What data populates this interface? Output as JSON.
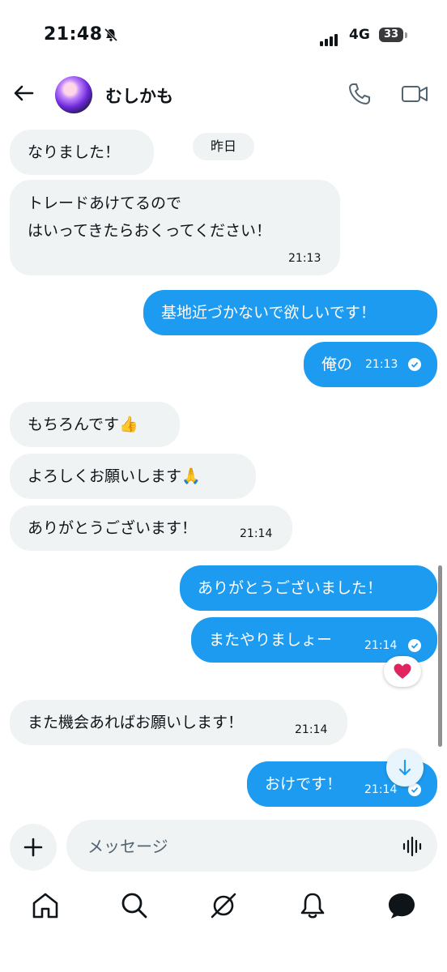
{
  "status_bar": {
    "time": "21:48",
    "network": "4G",
    "battery": "33"
  },
  "header": {
    "contact_name": "むしかも"
  },
  "day_separator": "昨日",
  "messages": [
    {
      "dir": "in",
      "text": "なりました！"
    },
    {
      "dir": "in",
      "lines": [
        "トレードあけてるので",
        "はいってきたらおくってください！"
      ],
      "time": "21:13"
    },
    {
      "dir": "out",
      "text": "基地近づかないで欲しいです！"
    },
    {
      "dir": "out",
      "text": "俺の",
      "time": "21:13"
    },
    {
      "dir": "in",
      "text": "もちろんです👍"
    },
    {
      "dir": "in",
      "text": "よろしくお願いします🙏"
    },
    {
      "dir": "in",
      "text": "ありがとうございます！",
      "time": "21:14"
    },
    {
      "dir": "out",
      "text": "ありがとうございました！"
    },
    {
      "dir": "out",
      "text": "またやりましょー",
      "time": "21:14"
    },
    {
      "dir": "in",
      "text": "また機会あればお願いします！",
      "time": "21:14"
    },
    {
      "dir": "out",
      "text": "おけです！",
      "time": "21:14"
    }
  ],
  "reaction": "❤️",
  "composer": {
    "placeholder": "メッセージ"
  },
  "icons": {
    "back": "back-arrow-icon",
    "call": "phone-icon",
    "video": "video-camera-icon",
    "plus": "plus-icon",
    "voice": "voice-wave-icon",
    "scroll": "arrow-down-icon",
    "nav": [
      "home-icon",
      "search-icon",
      "grok-icon",
      "notifications-icon",
      "messages-icon"
    ]
  },
  "colors": {
    "accent": "#1d9bf0",
    "incoming_bubble": "#eff3f4",
    "text": "#0f1419"
  }
}
